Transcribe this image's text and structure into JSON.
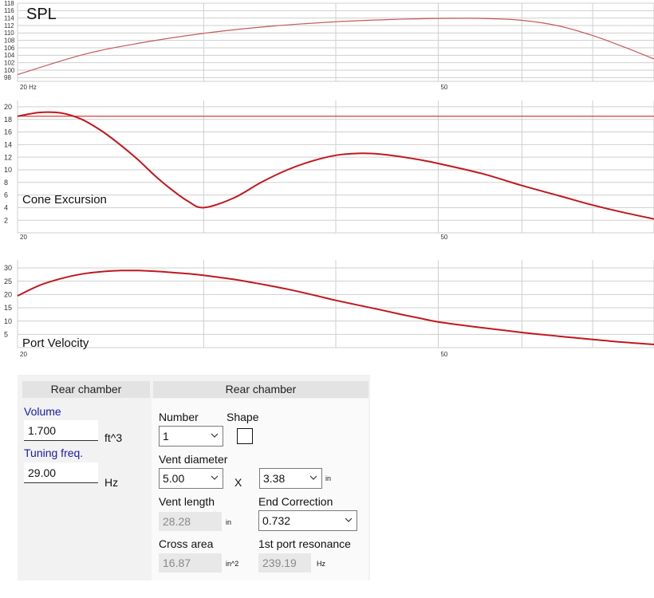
{
  "chart_data": [
    {
      "type": "line",
      "title": "SPL",
      "x_scale": "log",
      "xlim": [
        20,
        80
      ],
      "ylim": [
        97,
        118
      ],
      "y_ticks": [
        98,
        100,
        102,
        104,
        106,
        108,
        110,
        112,
        114,
        116,
        118
      ],
      "x_tick_labels": [
        {
          "x": 20,
          "label": "20 Hz"
        },
        {
          "x": 50,
          "label": "50"
        }
      ],
      "x_grid": [
        30,
        40,
        50,
        60,
        70,
        80
      ],
      "grid": true,
      "series": [
        {
          "x": [
            20,
            23,
            26,
            30,
            35,
            40,
            45,
            50,
            55,
            60,
            65,
            70,
            75,
            80
          ],
          "y": [
            98.8,
            104.1,
            107.2,
            109.9,
            111.9,
            113.0,
            113.6,
            113.9,
            113.9,
            113.4,
            111.9,
            109.3,
            106.2,
            103.0
          ]
        }
      ],
      "line_color": "#c45a5a"
    },
    {
      "type": "line",
      "title": "Cone Excursion",
      "x_scale": "log",
      "xlim": [
        20,
        80
      ],
      "ylim": [
        0,
        21
      ],
      "y_ticks": [
        2,
        4,
        6,
        8,
        10,
        12,
        14,
        16,
        18,
        20
      ],
      "x_tick_labels": [
        {
          "x": 20,
          "label": "20"
        },
        {
          "x": 50,
          "label": "50"
        }
      ],
      "x_grid": [
        30,
        40,
        50,
        60,
        70,
        80
      ],
      "grid": true,
      "reference_line": 18.5,
      "series": [
        {
          "x": [
            20,
            21,
            22,
            23,
            24,
            25,
            26,
            27,
            28,
            29,
            30,
            32,
            34,
            36,
            38,
            40,
            42,
            44,
            46,
            48,
            50,
            55,
            60,
            65,
            70,
            75,
            80
          ],
          "y": [
            18.5,
            19.1,
            19.0,
            18.0,
            16.2,
            14.0,
            11.6,
            9.0,
            6.8,
            5.0,
            4.0,
            5.5,
            8.0,
            10.0,
            11.4,
            12.3,
            12.6,
            12.5,
            12.1,
            11.6,
            11.0,
            9.4,
            7.5,
            5.9,
            4.4,
            3.2,
            2.2
          ]
        }
      ],
      "line_color": "#c0181e"
    },
    {
      "type": "line",
      "title": "Port  Velocity",
      "x_scale": "log",
      "xlim": [
        20,
        80
      ],
      "ylim": [
        0,
        33
      ],
      "y_ticks": [
        5,
        10,
        15,
        20,
        25,
        30
      ],
      "x_tick_labels": [
        {
          "x": 20,
          "label": "20"
        },
        {
          "x": 50,
          "label": "50"
        }
      ],
      "x_grid": [
        30,
        40,
        50,
        60,
        70,
        80
      ],
      "grid": true,
      "series": [
        {
          "x": [
            20,
            21,
            22,
            23,
            24,
            25,
            26,
            27,
            28,
            29,
            30,
            32,
            34,
            36,
            38,
            40,
            42,
            44,
            46,
            48,
            50,
            55,
            60,
            65,
            70,
            75,
            80
          ],
          "y": [
            19.5,
            23.5,
            26.0,
            27.7,
            28.6,
            29.0,
            29.0,
            28.7,
            28.3,
            27.8,
            27.2,
            25.7,
            23.9,
            22.0,
            19.9,
            17.8,
            16.0,
            14.3,
            12.6,
            11.1,
            9.7,
            7.5,
            5.7,
            4.3,
            3.1,
            2.0,
            1.2
          ]
        }
      ],
      "line_color": "#c0181e"
    }
  ],
  "colors": {
    "grid": "#cfcfcf",
    "axis_text": "#333333",
    "excursion": "#c0181e",
    "spl": "#c45a5a",
    "label_blue": "#1a1aa8"
  },
  "left_section": {
    "header": "Rear chamber",
    "volume": {
      "label": "Volume",
      "value": "1.700",
      "unit": "ft^3"
    },
    "tuning": {
      "label": "Tuning freq.",
      "value": "29.00",
      "unit": "Hz"
    }
  },
  "right_section": {
    "header": "Rear chamber",
    "number": {
      "label": "Number",
      "value": "1"
    },
    "shape": {
      "label": "Shape"
    },
    "vent_diameter": {
      "label": "Vent diameter",
      "value": "5.00",
      "x_label": "X",
      "value2": "3.38",
      "unit": "in"
    },
    "vent_length": {
      "label": "Vent length",
      "value": "28.28",
      "unit": "in"
    },
    "end_correction": {
      "label": "End Correction",
      "value": "0.732"
    },
    "cross_area": {
      "label": "Cross area",
      "value": "16.87",
      "unit": "in^2"
    },
    "port_resonance": {
      "label": "1st port resonance",
      "value": "239.19",
      "unit": "Hz"
    }
  }
}
